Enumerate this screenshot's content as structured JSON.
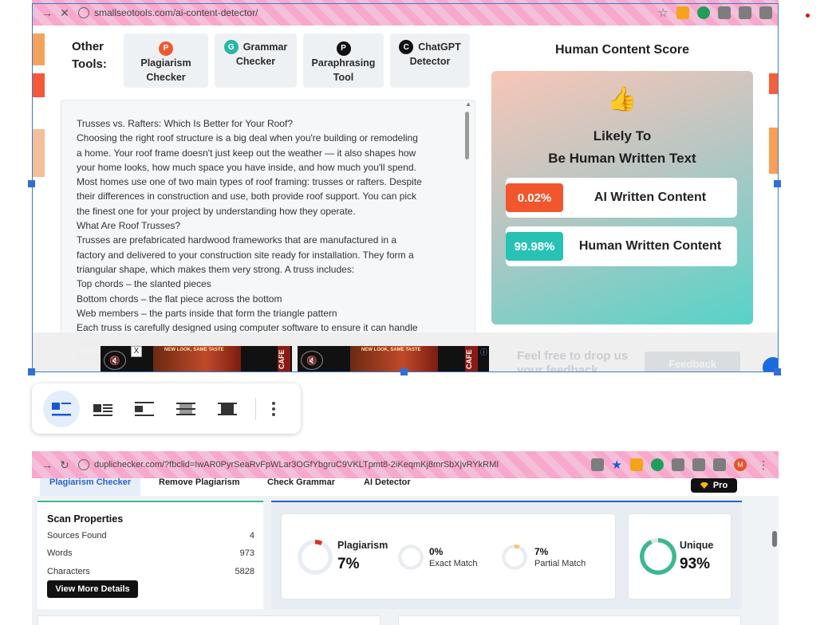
{
  "browser_top": {
    "url": "smallseotools.com/ai-content-detector/"
  },
  "other_tools": {
    "label_line1": "Other",
    "label_line2": "Tools:",
    "items": [
      {
        "badge": "P",
        "line1": "Plagiarism",
        "line2": "Checker",
        "color": "#ee5a2f"
      },
      {
        "badge": "G",
        "line1": "Grammar",
        "line2": "Checker",
        "color": "#2bb5a6"
      },
      {
        "badge": "P",
        "line1": "Paraphrasing",
        "line2": "Tool",
        "color": "#111111"
      },
      {
        "badge": "C",
        "line1": "ChatGPT",
        "line2": "Detector",
        "color": "#111111"
      }
    ]
  },
  "editor": {
    "lines": [
      "Trusses vs. Rafters: Which Is Better for Your Roof?",
      "Choosing the right roof structure is a big deal when you're building or remodeling",
      "a home. Your roof frame doesn't just keep out the weather — it also shapes how",
      "your home looks, how much space you have inside, and how much you'll spend.",
      "Most homes use one of two main types of roof framing: trusses or rafters. Despite",
      "their differences in construction and use, both provide roof support. You can pick",
      "the finest one for your project by understanding how they operate.",
      "What Are Roof Trusses?",
      "Trusses are prefabricated hardwood frameworks that are manufactured in a",
      "factory and delivered to your construction site ready for installation. They form a",
      "triangular shape, which makes them very strong. A truss includes:",
      "Top chords – the slanted pieces",
      "Bottom chords – the flat piece across the bottom",
      "Web members – the parts inside that form the triangle pattern",
      "Each truss is carefully designed using computer software to ensure it can handle",
      "weight correctly and efficiently. Large distances can be supported by trusses",
      "without"
    ]
  },
  "score": {
    "title": "Human Content Score",
    "emoji": "👍",
    "verdict_line1": "Likely To",
    "verdict_line2": "Be Human Written Text",
    "ai": {
      "percent": "0.02%",
      "label": "AI Written Content",
      "color": "#f2562c"
    },
    "human": {
      "percent": "99.98%",
      "label": "Human Written Content",
      "color": "#27c2b4"
    }
  },
  "ads": {
    "tagline": "NEW LOOK, SAME TASTE",
    "brand": "CAFE",
    "close": "X",
    "info": "ⓘ"
  },
  "feedback": {
    "line1": "Feel free to drop us",
    "line2": "your feedback",
    "button": "Feedback"
  },
  "browser_bottom": {
    "url": "duplichecker.com/?fbclid=IwAR0PyrSeaRvFpWLar3OGfYbgruC9VKLTpmt8-2iKeqmKj8mrSbXjvRYkRMI",
    "avatar": "M"
  },
  "dup_tabs": [
    {
      "label": "Plagiarism Checker",
      "active": true
    },
    {
      "label": "Remove Plagiarism",
      "active": false
    },
    {
      "label": "Check Grammar",
      "active": false
    },
    {
      "label": "AI Detector",
      "active": false
    }
  ],
  "pro_label": "Pro",
  "scan": {
    "title": "Scan Properties",
    "rows": [
      {
        "label": "Sources Found",
        "value": "4"
      },
      {
        "label": "Words",
        "value": "973"
      },
      {
        "label": "Characters",
        "value": "5828"
      }
    ],
    "button": "View More Details"
  },
  "metrics": {
    "plagiarism": {
      "label": "Plagiarism",
      "value": "7%",
      "fraction": 0.07
    },
    "exact": {
      "label": "Exact Match",
      "value": "0%",
      "fraction": 0
    },
    "partial": {
      "label": "Partial Match",
      "value": "7%",
      "fraction": 0.07
    },
    "unique": {
      "label": "Unique",
      "value": "93%",
      "fraction": 0.93
    }
  },
  "colors": {
    "accent_blue": "#2a62c9",
    "green": "#3cb88c",
    "plag_red": "#d9302b"
  }
}
